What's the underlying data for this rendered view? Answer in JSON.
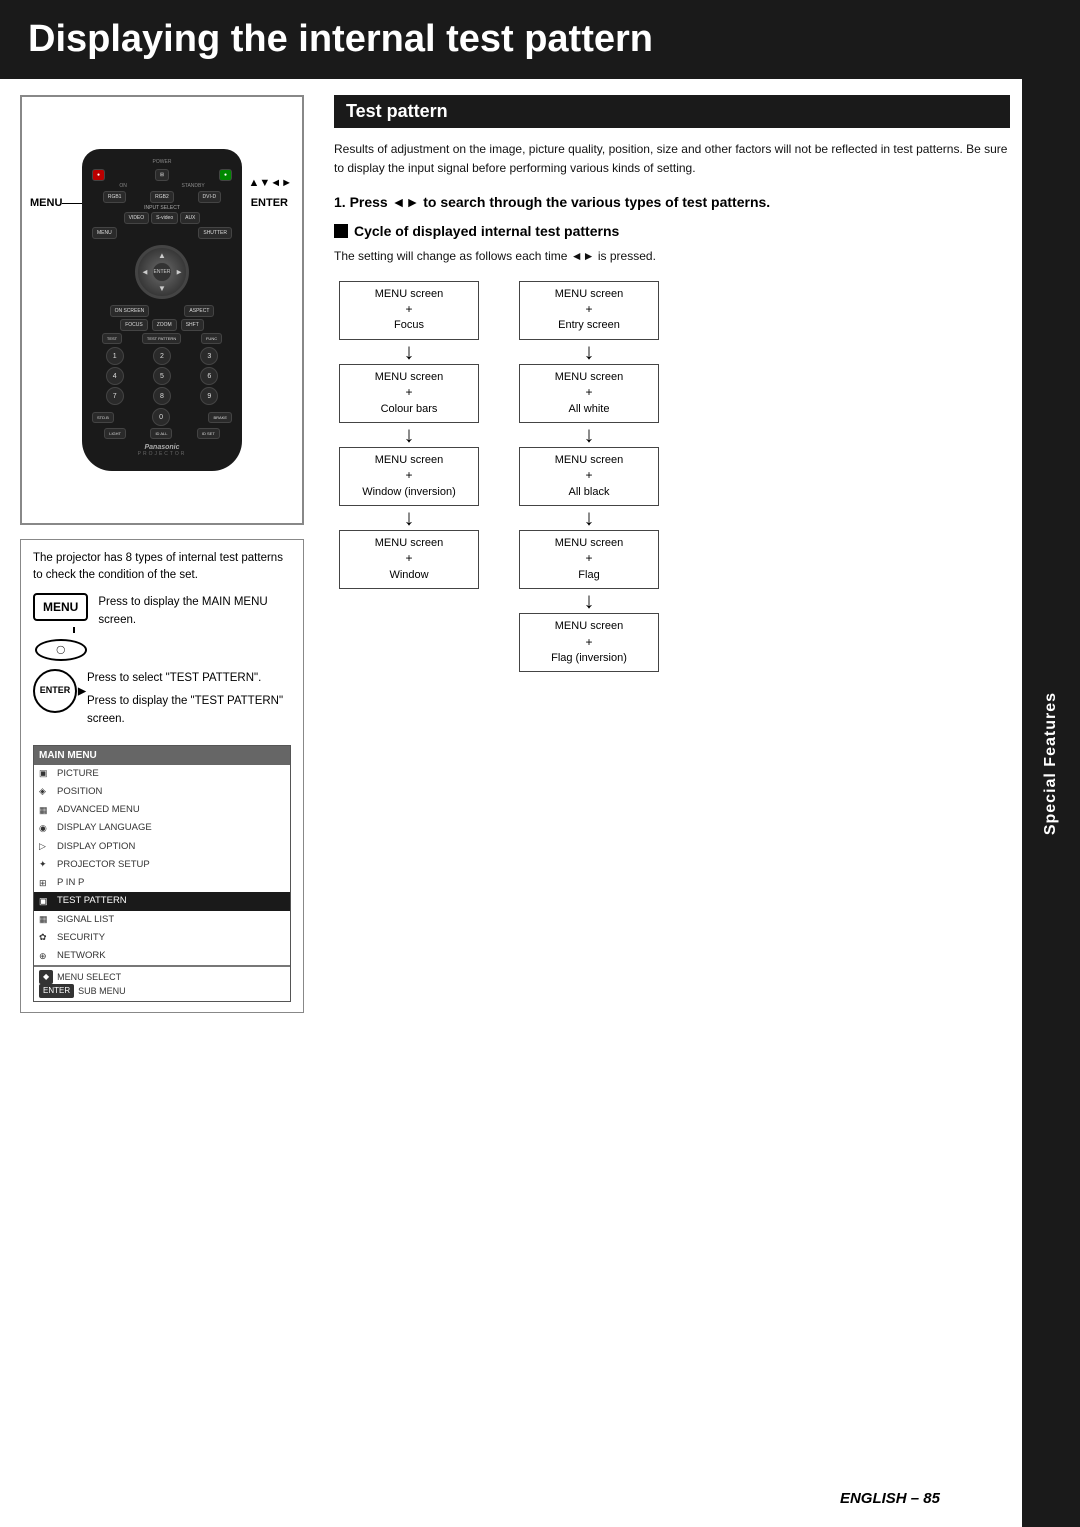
{
  "header": {
    "title": "Displaying the internal test pattern"
  },
  "left_col": {
    "info_box": {
      "text": "The projector has 8 types of internal test patterns to check the condition of the set."
    },
    "menu_button": {
      "label": "MENU",
      "instruction1": "Press to display the MAIN MENU screen."
    },
    "enter_button": {
      "label": "ENTER",
      "instruction2": "Press to select \"TEST PATTERN\".",
      "instruction3": "Press to display the \"TEST PATTERN\" screen."
    },
    "main_menu": {
      "header": "MAIN MENU",
      "items": [
        {
          "icon": "▣",
          "label": "PICTURE",
          "active": false
        },
        {
          "icon": "◈",
          "label": "POSITION",
          "active": false
        },
        {
          "icon": "▦",
          "label": "ADVANCED MENU",
          "active": false
        },
        {
          "icon": "◉",
          "label": "DISPLAY LANGUAGE",
          "active": false
        },
        {
          "icon": "▷",
          "label": "DISPLAY OPTION",
          "active": false
        },
        {
          "icon": "✦",
          "label": "PROJECTOR SETUP",
          "active": false
        },
        {
          "icon": "⊞",
          "label": "P IN P",
          "active": false
        },
        {
          "icon": "▣",
          "label": "TEST PATTERN",
          "active": true
        },
        {
          "icon": "▦",
          "label": "SIGNAL LIST",
          "active": false
        },
        {
          "icon": "✿",
          "label": "SECURITY",
          "active": false
        },
        {
          "icon": "⊕",
          "label": "NETWORK",
          "active": false
        }
      ],
      "footer1": "MENU SELECT",
      "footer2": "SUB MENU",
      "footer1_key": "◆",
      "footer2_key": "ENTER"
    }
  },
  "right_col": {
    "section_heading": "Test pattern",
    "intro_text": "Results of adjustment on the image, picture quality, position, size and other factors will not be reflected in test patterns. Be sure to display the input signal before performing various kinds of setting.",
    "step1": {
      "text": "Press ◄► to search through the various types of test patterns."
    },
    "cycle_heading": "Cycle of displayed internal test patterns",
    "cycle_text": "The setting will change as follows each time ◄► is pressed.",
    "flow": {
      "left_col": [
        {
          "lines": [
            "MENU screen",
            "+",
            "Focus"
          ],
          "arrow_before": null,
          "arrow_after": "down"
        },
        {
          "lines": [
            "MENU screen",
            "+",
            "Colour bars"
          ],
          "arrow_before": "down",
          "arrow_after": "up"
        },
        {
          "lines": [
            "MENU screen",
            "+",
            "Window (inversion)"
          ],
          "arrow_before": "up",
          "arrow_after": "down"
        },
        {
          "lines": [
            "MENU screen",
            "+",
            "Window"
          ],
          "arrow_before": "down",
          "arrow_after": null
        }
      ],
      "right_col": [
        {
          "lines": [
            "MENU screen",
            "+",
            "Entry screen"
          ],
          "arrow_before": null,
          "arrow_after": "down"
        },
        {
          "lines": [
            "MENU screen",
            "+",
            "All white"
          ],
          "arrow_before": "down",
          "arrow_after": "down"
        },
        {
          "lines": [
            "MENU screen",
            "+",
            "All black"
          ],
          "arrow_before": "down",
          "arrow_after": "down"
        },
        {
          "lines": [
            "MENU screen",
            "+",
            "Flag"
          ],
          "arrow_before": "down",
          "arrow_after": "down"
        },
        {
          "lines": [
            "MENU screen",
            "+",
            "Flag (inversion)"
          ],
          "arrow_before": "down",
          "arrow_after": null
        }
      ]
    }
  },
  "special_features": {
    "label": "Special Features"
  },
  "page_number": {
    "text": "ENGLISH – 85"
  }
}
